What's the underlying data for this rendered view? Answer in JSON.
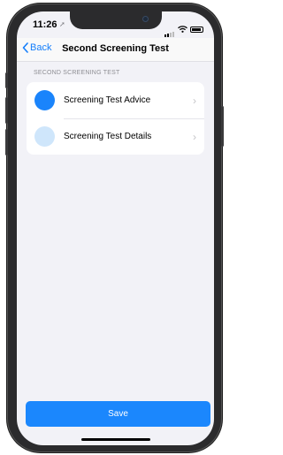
{
  "status_bar": {
    "time": "11:26",
    "location_glyph": "➚"
  },
  "nav": {
    "back_label": "Back",
    "title": "Second Screening Test"
  },
  "section": {
    "header": "SECOND SCREENING TEST"
  },
  "items": [
    {
      "label": "Screening Test Advice",
      "color": "#1a84fb"
    },
    {
      "label": "Screening Test Details",
      "color": "#cfe6fb"
    }
  ],
  "footer": {
    "save_label": "Save"
  },
  "colors": {
    "accent": "#147efb",
    "button": "#1b87fd",
    "background": "#f2f2f7"
  }
}
